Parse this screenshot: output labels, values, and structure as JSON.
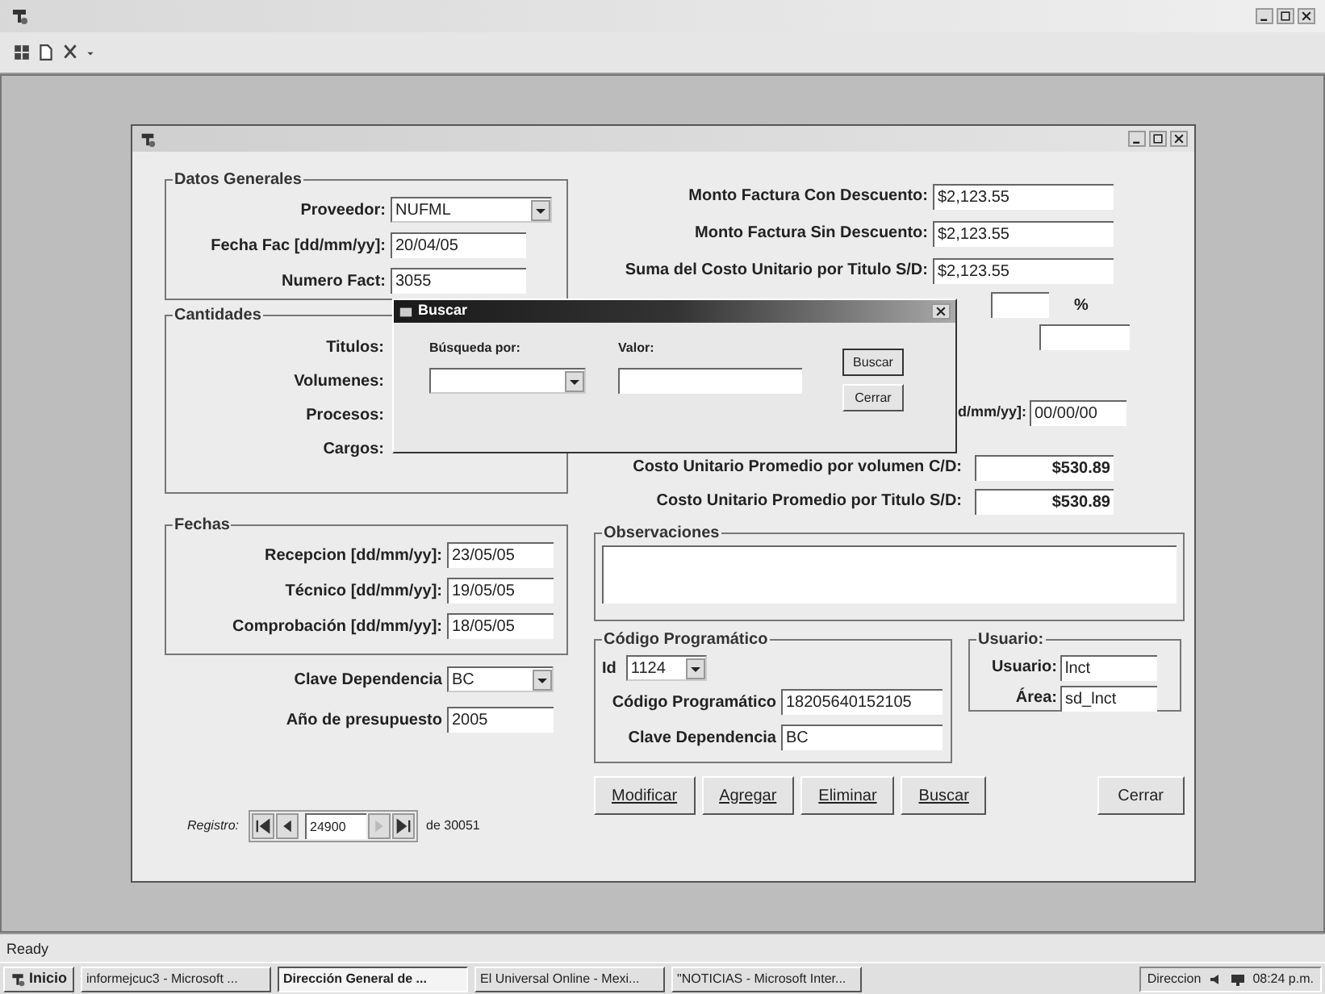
{
  "form": {
    "datos_generales": {
      "title": "Datos Generales",
      "fields": [
        {
          "label": "Proveedor:",
          "value": "NUFML",
          "kind": "combo"
        },
        {
          "label": "Fecha Fac [dd/mm/yy]:",
          "value": "20/04/05",
          "kind": "text"
        },
        {
          "label": "Numero Fact:",
          "value": "3055",
          "kind": "text"
        }
      ]
    },
    "cantidades": {
      "title": "Cantidades",
      "labels": [
        "Titulos:",
        "Volumenes:",
        "Procesos:",
        "Cargos:"
      ]
    },
    "fechas": {
      "title": "Fechas",
      "fields": [
        {
          "label": "Recepcion [dd/mm/yy]:",
          "value": "23/05/05",
          "kind": "text"
        },
        {
          "label": "Técnico [dd/mm/yy]:",
          "value": "19/05/05",
          "kind": "text"
        },
        {
          "label": "Comprobación [dd/mm/yy]:",
          "value": "18/05/05",
          "kind": "text"
        }
      ]
    },
    "extra_fields": [
      {
        "label": "Clave Dependencia",
        "value": "BC",
        "kind": "combo"
      },
      {
        "label": "Año de presupuesto",
        "value": "2005",
        "kind": "text"
      }
    ],
    "registro": {
      "label": "Registro:",
      "value": "24900",
      "total": "de 30051"
    },
    "montos": [
      {
        "label": "Monto Factura Con Descuento:",
        "value": "$2,123.55"
      },
      {
        "label": "Monto Factura Sin Descuento:",
        "value": "$2,123.55"
      },
      {
        "label": "Suma del Costo Unitario por Titulo S/D:",
        "value": "$2,123.55"
      }
    ],
    "percent_symbol": "%",
    "fecha_partial": {
      "label": "d/mm/yy]:",
      "value": "00/00/00"
    },
    "costos": [
      {
        "label": "Costo Unitario Promedio por volumen C/D:",
        "value": "$530.89"
      },
      {
        "label": "Costo Unitario Promedio por Titulo S/D:",
        "value": "$530.89"
      }
    ],
    "observaciones": {
      "title": "Observaciones"
    },
    "codigo_programatico": {
      "title": "Código Programático",
      "id_label": "Id",
      "id_value": "1124",
      "fields": [
        {
          "label": "Código Programático",
          "value": "18205640152105"
        },
        {
          "label": "Clave Dependencia",
          "value": "BC"
        }
      ]
    },
    "usuario": {
      "title": "Usuario:",
      "fields": [
        {
          "label": "Usuario:",
          "value": "lnct"
        },
        {
          "label": "Área:",
          "value": "sd_lnct"
        }
      ]
    },
    "buttons": [
      {
        "label": "Modificar"
      },
      {
        "label": "Agregar"
      },
      {
        "label": "Eliminar"
      },
      {
        "label": "Buscar"
      }
    ],
    "close_button": "Cerrar"
  },
  "buscar_dialog": {
    "title": "Buscar",
    "search_by_label": "Búsqueda por:",
    "value_label": "Valor:",
    "buttons": [
      "Buscar",
      "Cerrar"
    ]
  },
  "status_bar": "Ready",
  "taskbar": {
    "start": "Inicio",
    "tasks": [
      {
        "label": "informejcuc3 - Microsoft ...",
        "selected": false
      },
      {
        "label": "Dirección General de ...",
        "selected": true
      },
      {
        "label": "El Universal Online - Mexi...",
        "selected": false
      },
      {
        "label": "\"NOTICIAS - Microsoft Inter...",
        "selected": false
      }
    ],
    "tray_label": "Direccion",
    "time": "08:24 p.m."
  }
}
